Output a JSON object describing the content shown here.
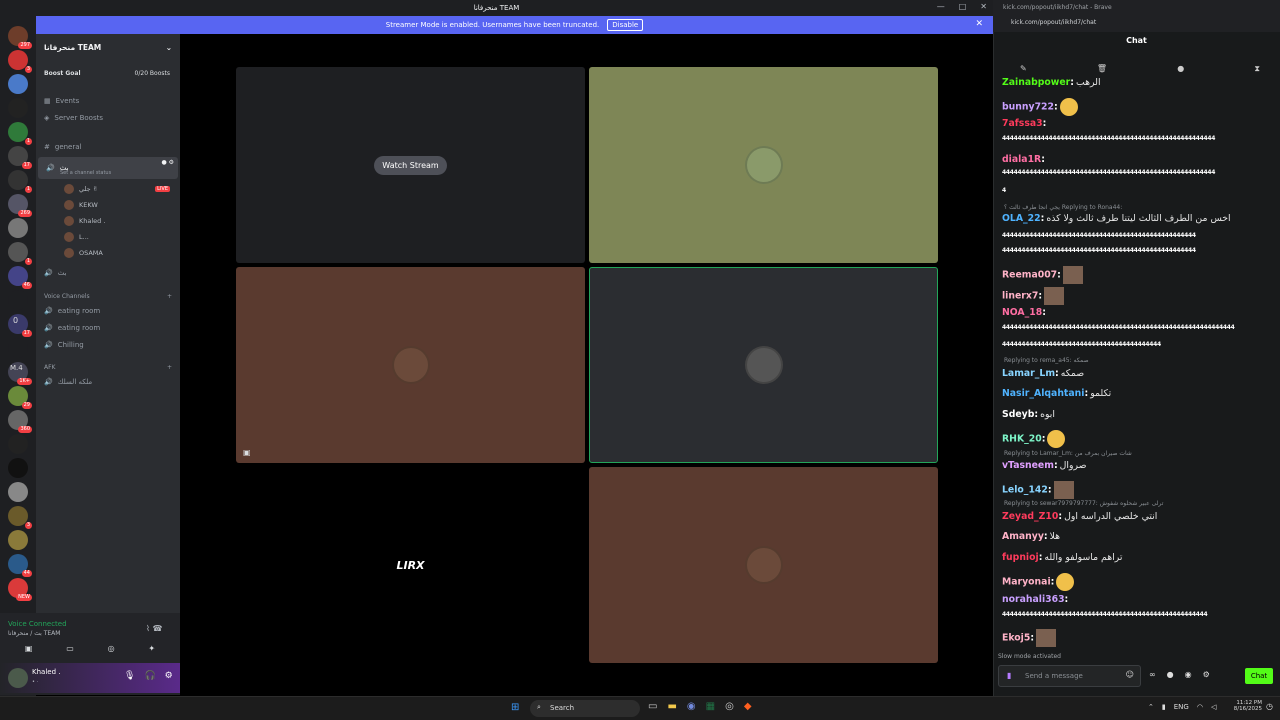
{
  "window": {
    "title": "منحرفانا TEAM"
  },
  "banner": {
    "text": "Streamer Mode is enabled. Usernames have been truncated.",
    "disable_label": "Disable"
  },
  "servers": [
    {
      "badge": "297"
    },
    {
      "badge": "3"
    },
    {
      "badge": ""
    },
    {
      "badge": ""
    },
    {
      "badge": "1"
    },
    {
      "badge": "17"
    },
    {
      "badge": "1"
    },
    {
      "badge": "269"
    },
    {
      "badge": ""
    },
    {
      "badge": "1"
    },
    {
      "badge": "46"
    },
    {
      "badge": ""
    },
    {
      "badge": "17"
    },
    {
      "badge": ""
    },
    {
      "badge": "1K+"
    },
    {
      "badge": "29"
    },
    {
      "badge": "360"
    },
    {
      "badge": ""
    },
    {
      "badge": ""
    },
    {
      "badge": ""
    },
    {
      "badge": "3"
    },
    {
      "badge": ""
    },
    {
      "badge": "44"
    },
    {
      "badge": "NEW"
    }
  ],
  "server_labels": {
    "zero": "0",
    "m4": "M.4"
  },
  "guild": {
    "name": "منحرفانا TEAM",
    "boost_goal": "Boost Goal",
    "boost_count": "0/20 Boosts"
  },
  "nav": {
    "events": "Events",
    "boosts": "Server Boosts"
  },
  "channels": {
    "general": "general",
    "voice_active": "بث",
    "set_status": "Set a channel status",
    "live": "LIVE",
    "members": [
      "جلي ✌",
      "KEKW",
      "Khaled .",
      "L...",
      "OSAMA"
    ],
    "voice_second": "بث",
    "voice_header": "Voice Channels",
    "voice": [
      "eating room",
      "eating room",
      "Chilling"
    ],
    "afk_header": "AFK",
    "afk": "ملكه السلك"
  },
  "voice_status": {
    "title": "Voice Connected",
    "sub": "بث / منحرفانا TEAM"
  },
  "user": {
    "name": "Khaled .",
    "status": "• ·"
  },
  "stage": {
    "watch": "Watch Stream",
    "logo": "LIRX"
  },
  "browser": {
    "url": "kick.com/popout/iikhd7/chat - Brave",
    "addr": "kick.com/popout/iikhd7/chat"
  },
  "chat": {
    "title": "Chat",
    "slow": "Slow mode activated",
    "placeholder": "Send a message",
    "send": "Chat",
    "messages": [
      {
        "u": "Zainabpower",
        "t": "الرهب",
        "c": "#53fc18"
      },
      {
        "u": "bunny722",
        "t": "",
        "c": "#c9a0ff"
      },
      {
        "u": "7afssa3",
        "t": "",
        "c": "#ff3b5c"
      },
      {
        "u": "4444444444444444444444444444444444444444444444444444444",
        "t": "",
        "c": "#ffffff"
      },
      {
        "u": "diala1R",
        "t": "",
        "c": "#ff6ea3"
      },
      {
        "u": "4444444444444444444444444444444444444444444444444444444",
        "t": "",
        "c": "#ffffff"
      },
      {
        "u": "4",
        "t": "",
        "c": "#ffffff"
      },
      {
        "u": "OLA_22",
        "t": "اخس من الطرف الثالث ليتنا طرف ثالث ولا كذه",
        "c": "#4fb3ff"
      },
      {
        "u": "44444444444444444444444444444444444444444444444444",
        "t": "",
        "c": "#ffffff"
      },
      {
        "u": "44444444444444444444444444444444444444444444444444",
        "t": "",
        "c": "#ffffff"
      },
      {
        "u": "Reema007",
        "t": "",
        "c": "#ffb3c8"
      },
      {
        "u": "linerx7",
        "t": "",
        "c": "#ffb3c8"
      },
      {
        "u": "NOA_18",
        "t": "",
        "c": "#ff6ea3"
      },
      {
        "u": "444444444444444444444444444444444444444444444444444444444444",
        "t": "",
        "c": "#ffffff"
      },
      {
        "u": "44444444444444444444444444444444444444444",
        "t": "",
        "c": "#ffffff"
      },
      {
        "u": "Lamar_Lm",
        "t": "صمكه",
        "c": "#88d4ff"
      },
      {
        "u": "Nasir_Alqahtani",
        "t": "تكلمو",
        "c": "#4fb3ff"
      },
      {
        "u": "Sdeyb",
        "t": "ابوه",
        "c": "#ffffff"
      },
      {
        "u": "RHK_20",
        "t": "",
        "c": "#7df5c8"
      },
      {
        "u": "vTasneem",
        "t": "صروال",
        "c": "#e0a0ff"
      },
      {
        "u": "Lelo_142",
        "t": "",
        "c": "#88d4ff"
      },
      {
        "u": "Zeyad_Z10",
        "t": "انتي خلصي الدراسه اول",
        "c": "#ff3b5c"
      },
      {
        "u": "Amanyy",
        "t": "هلا",
        "c": "#ffb3c8"
      },
      {
        "u": "fupnioj",
        "t": "تراهم ماسولفو والله",
        "c": "#ff3b5c"
      },
      {
        "u": "Maryonai",
        "t": "",
        "c": "#ffb3c8"
      },
      {
        "u": "norahali363",
        "t": "",
        "c": "#c9a0ff"
      },
      {
        "u": "44444444444444444444444444444444444444444444444444444",
        "t": "",
        "c": "#ffffff"
      },
      {
        "u": "Ekoj5",
        "t": "",
        "c": "#ffb3c8"
      }
    ],
    "replies": [
      "يجي انجا طرف ثالث ؟ Replying to Rona44:",
      "Replying to rema_a45: صمكه",
      "Replying to Lamar_Lm: شات صيران بمرف من",
      "Replying to sewar7979797777: ترلى عبير شحلوه شفوش",
      "Replying to"
    ]
  },
  "taskbar": {
    "search": "Search",
    "lang": "ENG",
    "time": "11:12 PM",
    "date": "8/16/2025"
  }
}
